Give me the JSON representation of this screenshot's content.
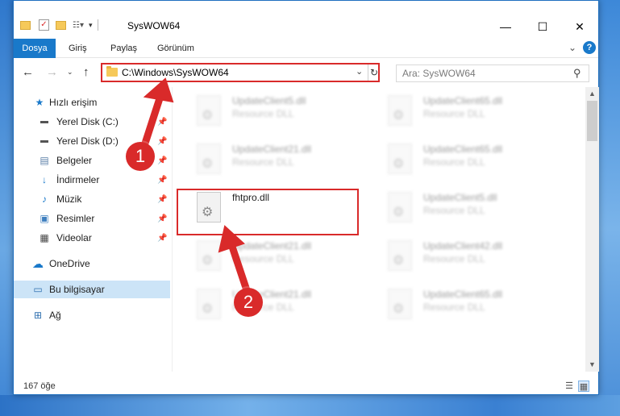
{
  "window": {
    "title": "SysWOW64",
    "controls": {
      "minimize": "—",
      "maximize": "☐",
      "close": "✕"
    }
  },
  "quick_access_toolbar": {
    "icons": [
      "folder-icon",
      "properties-icon",
      "new-folder-icon",
      "customize-icon"
    ]
  },
  "ribbon": {
    "tabs": [
      {
        "label": "Dosya",
        "active": true
      },
      {
        "label": "Giriş",
        "active": false
      },
      {
        "label": "Paylaş",
        "active": false
      },
      {
        "label": "Görünüm",
        "active": false
      }
    ],
    "help": "?"
  },
  "address_bar": {
    "path": "C:\\Windows\\SysWOW64",
    "search_placeholder": "Ara: SysWOW64"
  },
  "nav_pane": {
    "items": [
      {
        "label": "Hızlı erişim",
        "icon": "star-icon",
        "pinned": false
      },
      {
        "label": "Yerel Disk (C:)",
        "icon": "disk-icon",
        "pinned": true
      },
      {
        "label": "Yerel Disk (D:)",
        "icon": "disk-icon",
        "pinned": true
      },
      {
        "label": "Belgeler",
        "icon": "documents-icon",
        "pinned": true
      },
      {
        "label": "İndirmeler",
        "icon": "download-icon",
        "pinned": true
      },
      {
        "label": "Müzik",
        "icon": "music-icon",
        "pinned": true
      },
      {
        "label": "Resimler",
        "icon": "pictures-icon",
        "pinned": true
      },
      {
        "label": "Videolar",
        "icon": "videos-icon",
        "pinned": true
      },
      {
        "label": "OneDrive",
        "icon": "cloud-icon",
        "pinned": false
      },
      {
        "label": "Bu bilgisayar",
        "icon": "computer-icon",
        "pinned": false,
        "selected": true
      },
      {
        "label": "Ağ",
        "icon": "network-icon",
        "pinned": false
      }
    ]
  },
  "files": [
    {
      "name": "UpdateClient5.dll",
      "type": "Resource DLL",
      "blurred": true
    },
    {
      "name": "UpdateClient65.dll",
      "type": "Resource DLL",
      "blurred": true
    },
    {
      "name": "UpdateClient21.dll",
      "type": "Resource DLL",
      "blurred": true
    },
    {
      "name": "UpdateClient65.dll",
      "type": "Resource DLL",
      "blurred": true
    },
    {
      "name": "fhtpro.dll",
      "type": "",
      "blurred": false,
      "highlighted": true
    },
    {
      "name": "UpdateClient5.dll",
      "type": "Resource DLL",
      "blurred": true
    },
    {
      "name": "UpdateClient21.dll",
      "type": "Resource DLL",
      "blurred": true
    },
    {
      "name": "UpdateClient42.dll",
      "type": "Resource DLL",
      "blurred": true
    },
    {
      "name": "UpdateClient21.dll",
      "type": "Resource DLL",
      "blurred": true
    },
    {
      "name": "UpdateClient65.dll",
      "type": "Resource DLL",
      "blurred": true
    }
  ],
  "status_bar": {
    "item_count": "167 öğe"
  },
  "annotations": {
    "step1": "1",
    "step2": "2",
    "color": "#d92a2a"
  }
}
